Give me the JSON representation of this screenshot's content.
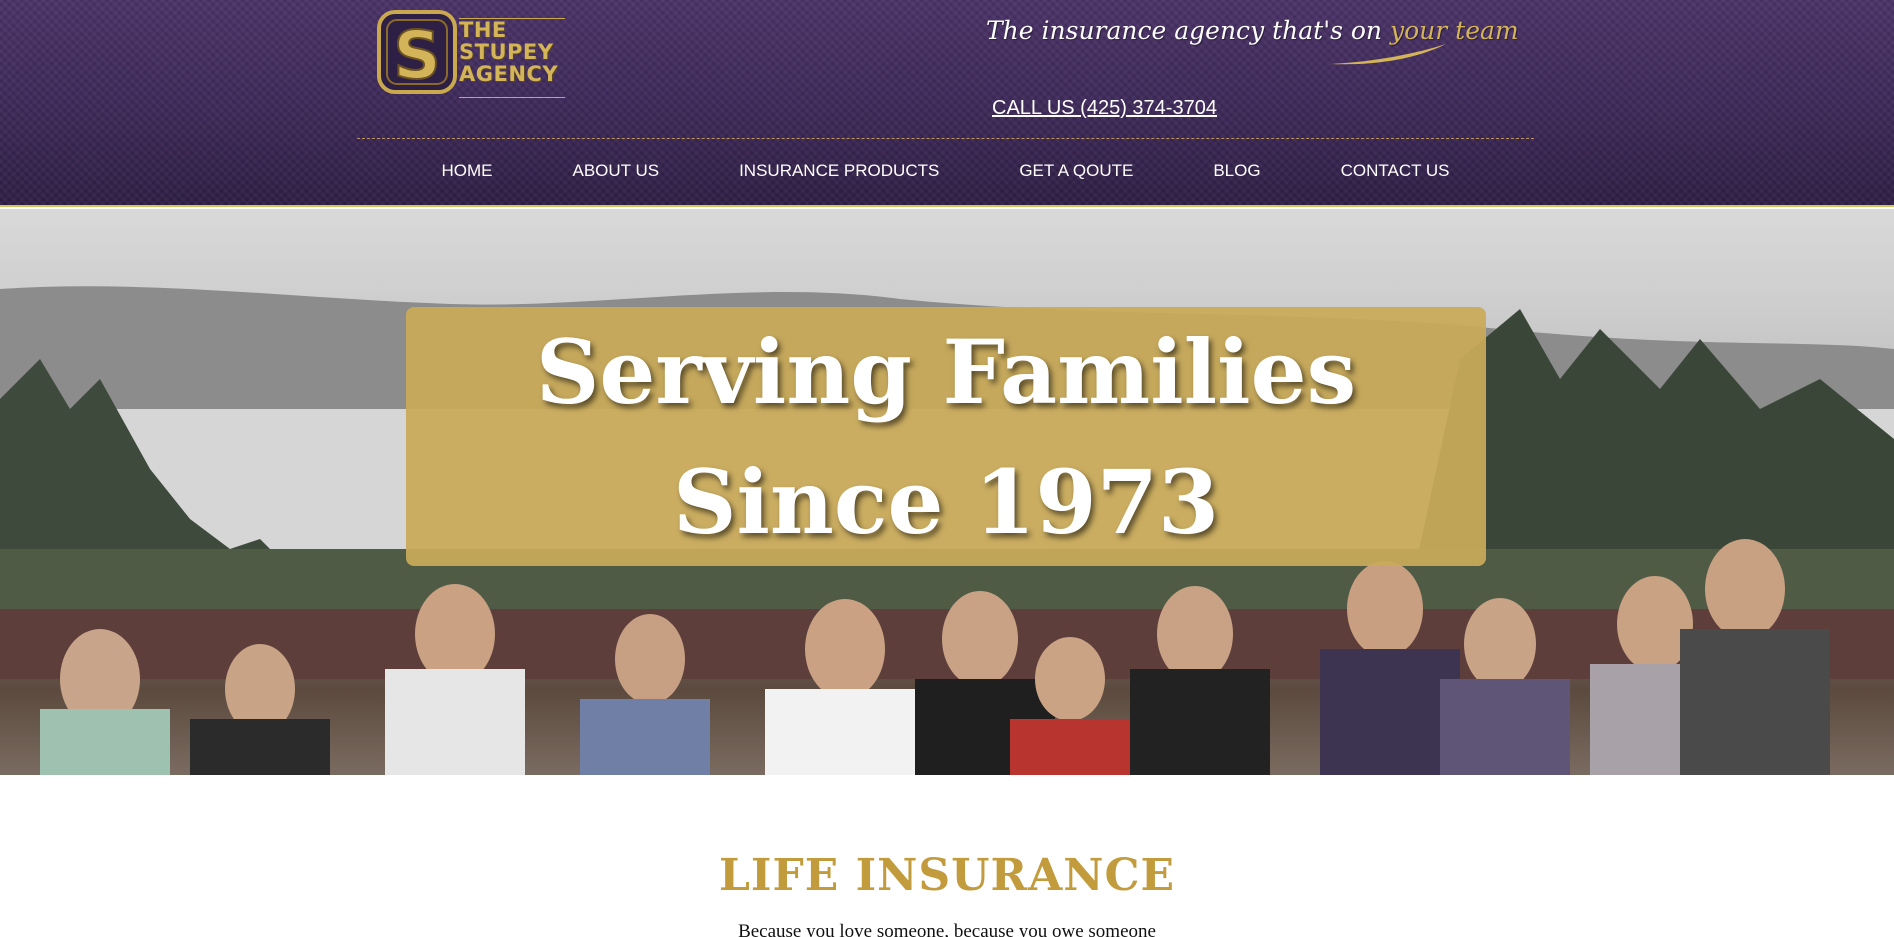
{
  "header": {
    "logo": {
      "line1": "THE",
      "line2": "STUPEY",
      "line3": "AGENCY",
      "mark": "S"
    },
    "tagline": {
      "main": "The insurance agency that's on",
      "accent": "your team"
    },
    "call": "CALL US (425) 374-3704"
  },
  "nav": {
    "items": [
      {
        "label": "HOME"
      },
      {
        "label": "ABOUT US"
      },
      {
        "label": "INSURANCE PRODUCTS"
      },
      {
        "label": "GET A QOUTE"
      },
      {
        "label": "BLOG"
      },
      {
        "label": "CONTACT US"
      }
    ]
  },
  "hero": {
    "title": "Serving Families Since 1973"
  },
  "section": {
    "title": "LIFE INSURANCE",
    "subtitle": "Because you love someone, because you owe someone"
  },
  "colors": {
    "header": "#3f2a5a",
    "gold": "#c9aa58",
    "heading_gold": "#c29b3d"
  }
}
